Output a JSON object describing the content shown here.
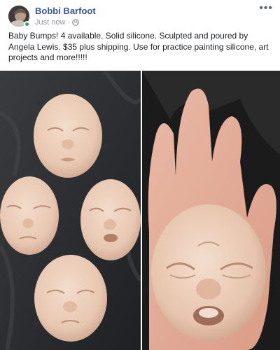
{
  "post": {
    "author": "Bobbi Barfoot",
    "timestamp": "Just now",
    "separator": "·",
    "privacy_icon": "globe-icon",
    "more_icon": "more-options-icon",
    "more_glyph": "•••",
    "text": "Baby Bumps! 4 available. Solid silicone. Sculpted and poured by Angela Lewis. $35 plus shipping. Use for practice painting silicone, art projects and more!!!!!"
  },
  "colors": {
    "author_link": "#385898",
    "meta_text": "#90949c",
    "online": "#31a24c"
  }
}
